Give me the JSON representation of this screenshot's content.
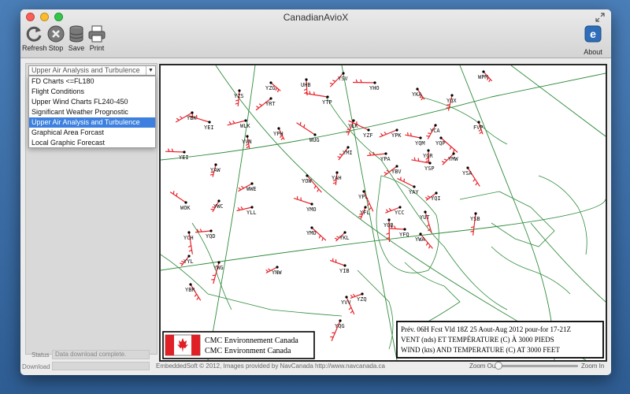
{
  "window": {
    "title": "CanadianAvioX"
  },
  "toolbar": {
    "refresh_label": "Refresh",
    "stop_label": "Stop",
    "save_label": "Save",
    "print_label": "Print",
    "about_label": "About"
  },
  "sidebar": {
    "selected_value": "Upper Air Analysis and Turbulence",
    "options": [
      "FD Charts <=FL180",
      "Flight Conditions",
      "Upper Wind Charts FL240-450",
      "Significant Weather Prognostic",
      "Upper Air Analysis and Turbulence",
      "Graphical Area Forcast",
      "Local Graphic Forecast"
    ]
  },
  "map": {
    "legend_line1": "CMC Environnement Canada",
    "legend_line2": "CMC Environment Canada",
    "info_line1": "Prév. 06H Fcst Vld 18Z 25 Aout-Aug 2012 pour-for 17-21Z",
    "info_line2": "VENT (nds) ET TEMPÉRATURE (C) À 3000 PIEDS",
    "info_line3": "WIND (kts) AND TEMPERATURE (C) AT 3000 FEET",
    "stations": [
      "YZG",
      "UHB",
      "YSV",
      "YHO",
      "WPM",
      "YZS",
      "YRT",
      "YTP",
      "YKA",
      "YQX",
      "YBK",
      "YEI",
      "YPH",
      "YLK",
      "YPK",
      "YZF",
      "FVP",
      "YCA",
      "WLK",
      "WUG",
      "YVN",
      "YMI",
      "YPA",
      "YQP",
      "YGR",
      "YMW",
      "YEI",
      "YOW",
      "YAH",
      "YBV",
      "YSP",
      "YSA",
      "YAW",
      "WWE",
      "YMO",
      "YPL",
      "YFL",
      "YCC",
      "YAY",
      "YUT",
      "YWC",
      "YLL",
      "WOK",
      "YCH",
      "YYL",
      "YQD",
      "YMO",
      "YQB",
      "YKL",
      "YFQ",
      "YWA",
      "YSB",
      "YQI",
      "YQM",
      "YBR",
      "YWG",
      "YNW",
      "YIB",
      "YVV",
      "YQG",
      "YZQ"
    ]
  },
  "status": {
    "label": "Status",
    "value": "Data download complete.",
    "download_label": "Download"
  },
  "footer": {
    "credit": "EmbeddedSoft © 2012, Images provided by NavCanada http://www.navcanada.ca",
    "zoom_out": "Zoom Out",
    "zoom_in": "Zoom In"
  },
  "colors": {
    "selection": "#3d80df",
    "map_lines": "#2e8b3a",
    "wind_barbs": "#e8232a",
    "flag_red": "#e01f26"
  }
}
